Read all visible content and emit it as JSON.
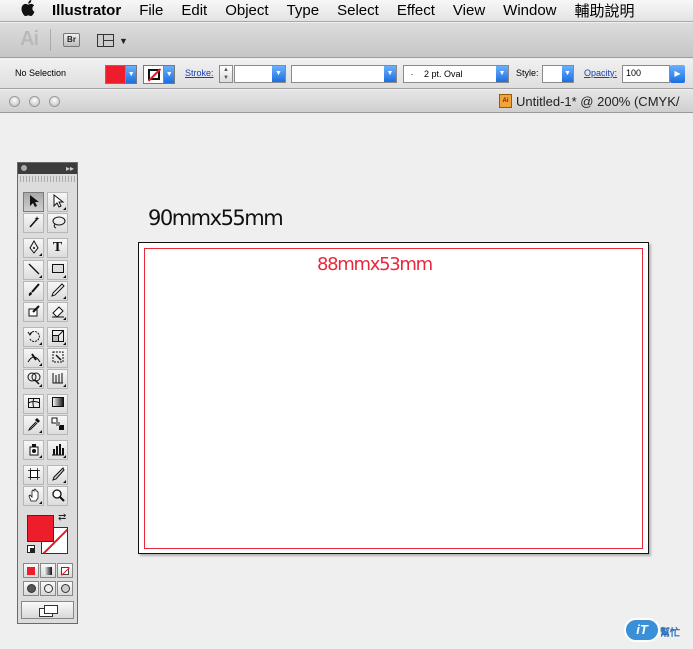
{
  "menubar": {
    "apple": "",
    "app_name": "Illustrator",
    "items": [
      "File",
      "Edit",
      "Object",
      "Type",
      "Select",
      "Effect",
      "View",
      "Window",
      "輔助說明"
    ]
  },
  "appbar": {
    "logo": "Ai",
    "bridge_label": "Br"
  },
  "controlbar": {
    "selection_status": "No Selection",
    "fill_color": "#ee1d2c",
    "stroke_label": "Stroke:",
    "stroke_weight": "",
    "brush_dot": "·",
    "brush_value": "2 pt. Oval",
    "style_label": "Style:",
    "opacity_label": "Opacity:",
    "opacity_value": "100"
  },
  "document": {
    "icon_label": "Ai",
    "title": "Untitled-1* @ 200% (CMYK/"
  },
  "tools_panel": {
    "collapse": "▸▸",
    "type_tool": "T"
  },
  "canvas": {
    "outer_size_label": "90mmx55mm",
    "inner_size_label": "88mmx53mm",
    "safe_area_color": "#e8283a"
  },
  "watermark": {
    "badge": "iT",
    "text": "幫忙"
  }
}
